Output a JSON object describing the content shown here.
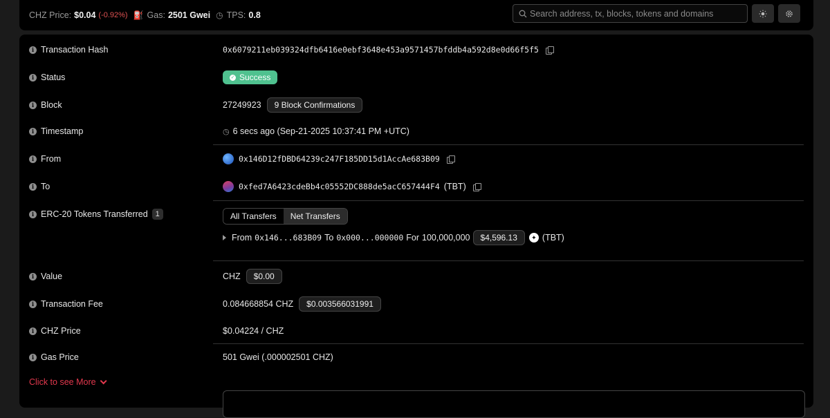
{
  "topbar": {
    "price_label": "CHZ Price:",
    "price_value": "$0.04",
    "price_change": "(-0.92%)",
    "gas_label": "Gas:",
    "gas_value": "2501 Gwei",
    "tps_label": "TPS:",
    "tps_value": "0.8",
    "search_placeholder": "Search address, tx, blocks, tokens and domains",
    "theme_icon": "sun-icon",
    "settings_icon": "gear-icon"
  },
  "tx": {
    "hash_label": "Transaction Hash",
    "hash": "0x6079211eb039324dfb6416e0ebf3648e453a9571457bfddb4a592d8e0d66f5f5",
    "status_label": "Status",
    "status": "Success",
    "block_label": "Block",
    "block": "27249923",
    "confirmations": "9 Block Confirmations",
    "timestamp_label": "Timestamp",
    "timestamp": "6 secs ago (Sep-21-2025 10:37:41 PM +UTC)",
    "from_label": "From",
    "from": "0x146D12fDBD64239c247F185DD15d1AccAe683B09",
    "to_label": "To",
    "to": "0xfed7A6423cdeBb4c05552DC888de5acC657444F4",
    "to_tag": "(TBT)",
    "erc20_label": "ERC-20 Tokens Transferred",
    "erc20_count": "1",
    "tab_all": "All Transfers",
    "tab_net": "Net Transfers",
    "transfer": {
      "from_word": "From",
      "from_addr": "0x146...683B09",
      "to_word": "To",
      "to_addr": "0x000...000000",
      "for_word": "For",
      "amount": "100,000,000",
      "usd": "$4,596.13",
      "token": "(TBT)"
    },
    "value_label": "Value",
    "value": "CHZ",
    "value_usd": "$0.00",
    "fee_label": "Transaction Fee",
    "fee": "0.084668854 CHZ",
    "fee_usd": "$0.003566031991",
    "chz_price_label": "CHZ Price",
    "chz_price": "$0.04224 / CHZ",
    "gas_price_label": "Gas Price",
    "gas_price": "501 Gwei (.000002501 CHZ)",
    "more": "Click to see More"
  },
  "colors": {
    "success": "#4fc18f",
    "negative": "#e05252",
    "link_red": "#e2384d"
  }
}
